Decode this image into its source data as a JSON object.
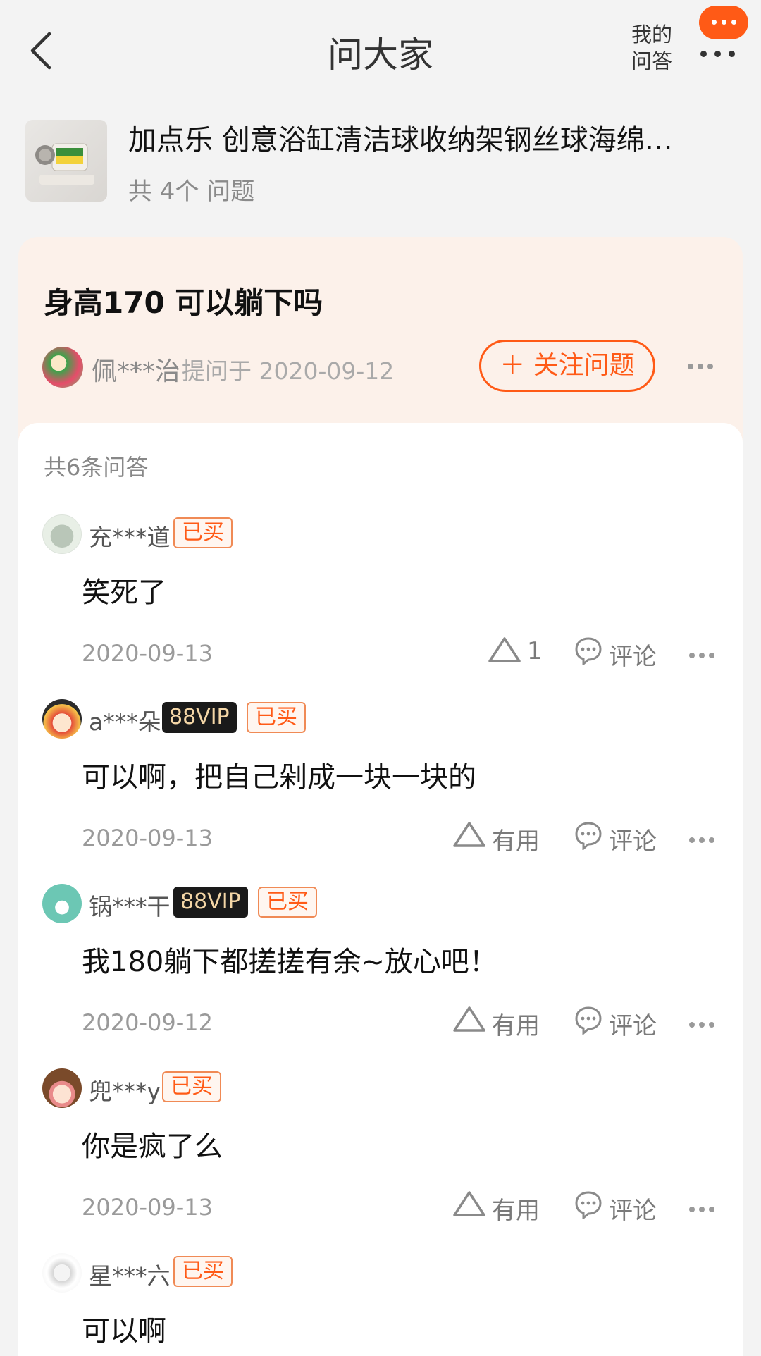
{
  "header": {
    "title": "问大家",
    "my_answers_line1": "我的",
    "my_answers_line2": "问答"
  },
  "product": {
    "title": "加点乐 创意浴缸清洁球收纳架钢丝球海绵…",
    "question_count": "共 4个 问题"
  },
  "question": {
    "title": "身高170 可以躺下吗",
    "asker": "佩***治",
    "asked_at": "提问于 2020-09-12",
    "follow_label": "关注问题"
  },
  "answers_summary": "共6条问答",
  "answers": [
    {
      "user": "充***道",
      "vip": "",
      "badge": "已买",
      "text": "笑死了",
      "date": "2020-09-13",
      "useful": "1",
      "comment": "评论"
    },
    {
      "user": "a***朵",
      "vip": "88VIP",
      "badge": "已买",
      "text": "可以啊，把自己剁成一块一块的",
      "date": "2020-09-13",
      "useful": "有用",
      "comment": "评论"
    },
    {
      "user": "锅***干",
      "vip": "88VIP",
      "badge": "已买",
      "text": "我180躺下都搓搓有余~放心吧！",
      "date": "2020-09-12",
      "useful": "有用",
      "comment": "评论"
    },
    {
      "user": "兜***y",
      "vip": "",
      "badge": "已买",
      "text": "你是疯了么",
      "date": "2020-09-13",
      "useful": "有用",
      "comment": "评论"
    },
    {
      "user": "星***六",
      "vip": "",
      "badge": "已买",
      "text": "可以啊",
      "date": "",
      "useful": "",
      "comment": ""
    }
  ],
  "colors": {
    "accent": "#ff5a16",
    "question_bg": "#fcf1ea",
    "page_bg": "#f3f3f3"
  }
}
